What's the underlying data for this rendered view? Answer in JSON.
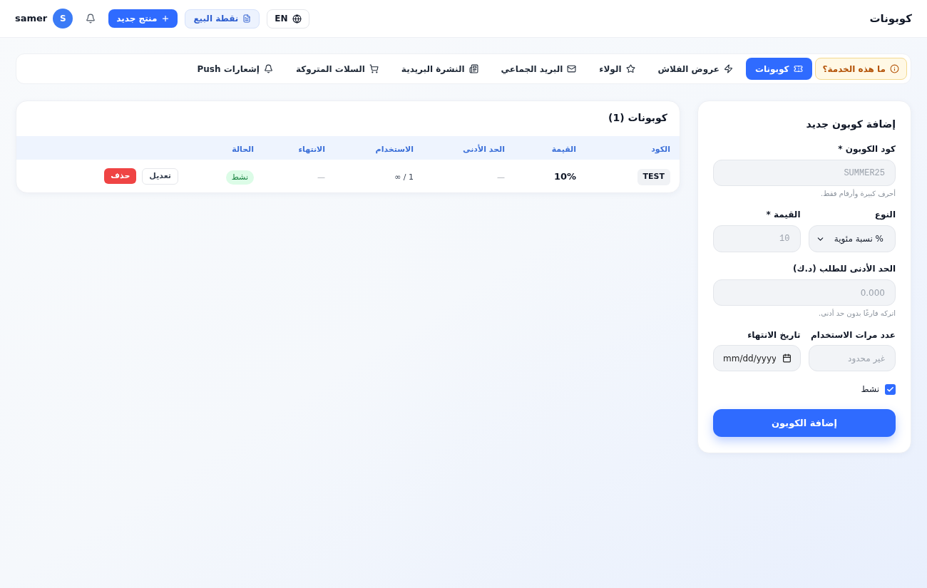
{
  "header": {
    "title": "كوبونات",
    "language_button": "EN",
    "pos_button": "نقطة البيع",
    "new_product_button": "منتج جديد",
    "user": {
      "initial": "S",
      "name": "samer"
    }
  },
  "nav": {
    "help_button": "ما هذه الخدمة؟",
    "tabs": [
      {
        "label": "كوبونات",
        "selected": true
      },
      {
        "label": "عروض الفلاش",
        "selected": false
      },
      {
        "label": "الولاء",
        "selected": false
      },
      {
        "label": "البريد الجماعي",
        "selected": false
      },
      {
        "label": "النشرة البريدية",
        "selected": false
      },
      {
        "label": "السلات المتروكة",
        "selected": false
      },
      {
        "label": "إشعارات Push",
        "selected": false
      }
    ]
  },
  "form": {
    "title": "إضافة كوبون جديد",
    "code": {
      "label": "كود الكوبون *",
      "placeholder": "SUMMER25",
      "hint": "أحرف كبيرة وأرقام فقط."
    },
    "type": {
      "label": "النوع",
      "value": "% نسبة مئوية"
    },
    "value": {
      "label": "القيمة *",
      "placeholder": "10"
    },
    "min_order": {
      "label": "الحد الأدنى للطلب (د.ك)",
      "placeholder": "0.000",
      "hint": "اتركه فارغًا بدون حد أدنى."
    },
    "usage_limit": {
      "label": "عدد مرات الاستخدام",
      "placeholder": "غير محدود"
    },
    "expiry": {
      "label": "تاريخ الانتهاء",
      "placeholder": "mm/dd/yyyy"
    },
    "active": {
      "label": "نشط",
      "checked": true
    },
    "submit": "إضافة الكوبون"
  },
  "coupons": {
    "title": "كوبونات (1)",
    "columns": [
      "الكود",
      "القيمة",
      "الحد الأدنى",
      "الاستخدام",
      "الانتهاء",
      "الحالة"
    ],
    "rows": [
      {
        "code": "TEST",
        "value": "10%",
        "min_order": "—",
        "usage": "1 / ∞",
        "expiry": "—",
        "status": {
          "label": "نشط",
          "active": true
        },
        "actions": [
          {
            "kind": "edit",
            "label": "تعديل"
          },
          {
            "kind": "delete",
            "label": "حذف"
          }
        ]
      }
    ]
  }
}
